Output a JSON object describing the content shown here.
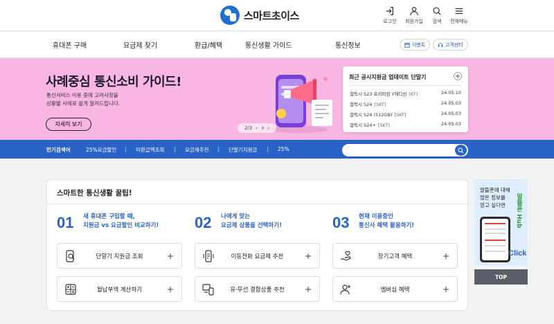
{
  "header": {
    "logo_text": "스마트초이스",
    "utils": [
      {
        "label": "로그인",
        "icon": "login-icon"
      },
      {
        "label": "회원가입",
        "icon": "user-icon"
      },
      {
        "label": "검색",
        "icon": "search-icon"
      },
      {
        "label": "전체메뉴",
        "icon": "menu-icon"
      }
    ]
  },
  "gnb": {
    "items": [
      "휴대폰 구매",
      "요금제 찾기",
      "환급/혜택",
      "통신생활 가이드",
      "통신정보"
    ],
    "event_label": "이벤트",
    "support_label": "고객센터"
  },
  "banner": {
    "title": "사례중심 통신소비 가이드!",
    "desc": "통신서비스 이용 중에 고려사항을\n상황별 사례로 쉽게 알려드립니다.",
    "button": "자세히 보기",
    "pager_text": "2/3",
    "pager_prev": "‹",
    "pager_pause": "॥",
    "pager_next": "›",
    "bg_color": "#f9b6e3"
  },
  "notice": {
    "title": "최근 공시지원금 업데이트 단말기",
    "rows": [
      {
        "name": "갤럭시 S23 프리미엄 Y에디션",
        "tag": "[KT]",
        "date": "24.05.10"
      },
      {
        "name": "갤럭시 S24",
        "tag": "[SKT]",
        "date": "24.05.03"
      },
      {
        "name": "갤럭시 S24 (512GB)",
        "tag": "[SKT]",
        "date": "24.05.03"
      },
      {
        "name": "갤럭시 S24+",
        "tag": "[SKT]",
        "date": "24.05.03"
      }
    ]
  },
  "search": {
    "heading": "인기검색어",
    "keywords": [
      "25%요금할인",
      "미환급액조회",
      "요금제추천",
      "단말기지원금",
      "25%"
    ],
    "placeholder": "",
    "accent": "#2a63c8"
  },
  "tips": {
    "title": "스마트한 통신생활 꿀팁!",
    "steps": [
      {
        "num": "01",
        "text": "새 휴대폰 구입할 때,\n지원금 vs 요금할인 비교하기!"
      },
      {
        "num": "02",
        "text": "나에게 맞는\n요금제 상품을 선택하기!"
      },
      {
        "num": "03",
        "text": "현재 이용중인\n통신사 혜택 활용하기!"
      }
    ],
    "buttons": [
      {
        "label": "단말기 지원금 조회",
        "icon": "phone-search-icon"
      },
      {
        "label": "이동전화 요금제 추천",
        "icon": "phone-plan-icon"
      },
      {
        "label": "장기고객 혜택",
        "icon": "hand-heart-icon"
      },
      {
        "label": "월납부액 계산하기",
        "icon": "calculator-icon"
      },
      {
        "label": "유·무선 결합상품 추천",
        "icon": "devices-icon"
      },
      {
        "label": "멤버십 혜택",
        "icon": "member-icon"
      }
    ]
  },
  "side_ad": {
    "text": "알뜰폰에 대해\n많은 정보를\n얻고 싶다면",
    "brand": "알뜰폰 Hub",
    "click": "Click"
  },
  "top_button": "TOP"
}
